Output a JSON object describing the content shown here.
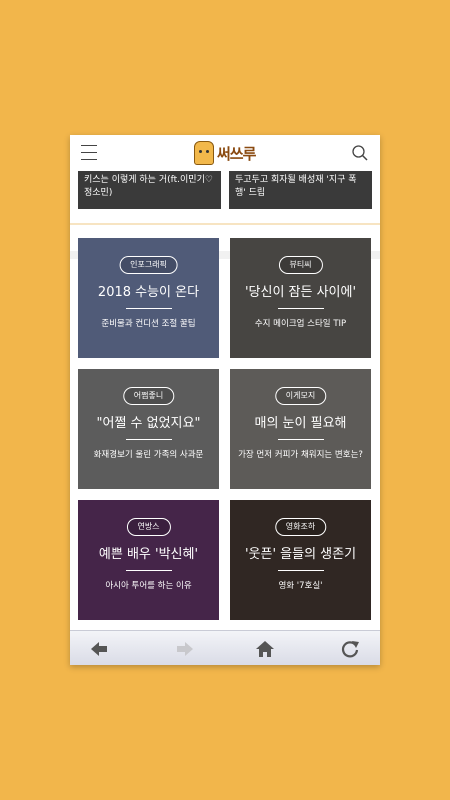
{
  "header": {
    "logo_text": "써쓰루"
  },
  "top_cards": [
    {
      "text": "키스는 이렇게 하는 거(ft.이민기♡정소민)"
    },
    {
      "text": "두고두고 회자될 배성재 '지구 폭행' 드립"
    }
  ],
  "cards": [
    {
      "badge": "인포그래픽",
      "title": "2018 수능이 온다",
      "subtitle": "준비물과 컨디션 조절 꿀팁",
      "bg": "#7b8db8"
    },
    {
      "badge": "뷰티씨",
      "title": "'당신이 잠든 사이에'",
      "subtitle": "수지 메이크업 스타일 TIP",
      "bg": "#6e6a66"
    },
    {
      "badge": "어쩜좋니",
      "title": "\"어쩔 수 없었지요\"",
      "subtitle": "화재경보기 울린 가족의 사과문",
      "bg": "#8e8e8e"
    },
    {
      "badge": "이게모지",
      "title": "매의 눈이 필요해",
      "subtitle": "가장 먼저 커피가 채워지는 변호는?",
      "bg": "#8f8c88"
    },
    {
      "badge": "연방스",
      "title": "예쁜 배우 '박신혜'",
      "subtitle": "아시아 투어를 하는 이유",
      "bg": "#6a3a70"
    },
    {
      "badge": "영화조하",
      "title": "'웃픈' 을들의 생존기",
      "subtitle": "영화 '7호실'",
      "bg": "#4a3c36"
    }
  ],
  "nav": {
    "back_icon": "back-arrow-icon",
    "forward_icon": "forward-arrow-icon",
    "home_icon": "home-icon",
    "refresh_icon": "refresh-icon"
  }
}
